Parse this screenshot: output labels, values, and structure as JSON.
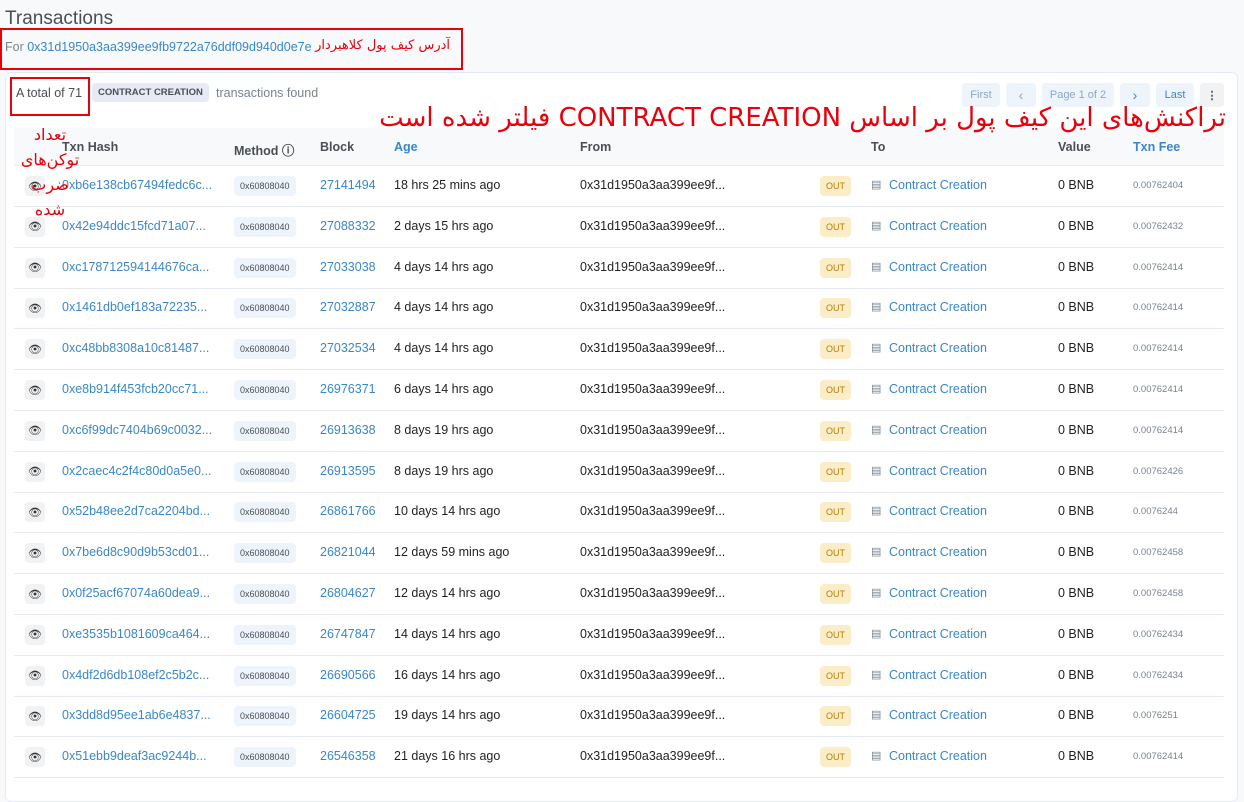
{
  "page": {
    "title": "Transactions",
    "for_label": "For",
    "address": "0x31d1950a3aa399ee9fb9722a76ddf09d940d0e7e"
  },
  "annotations": {
    "address_note": "آدرس کیف پول کلاهبردار",
    "filter_note": "تراکنش‌های این کیف پول بر اساس CONTRACT CREATION فیلتر شده است",
    "count_note": "تعداد توکن‌های ضرب شده",
    "color": "#e8000b"
  },
  "summary": {
    "total": "A total of 71",
    "filter_badge": "CONTRACT CREATION",
    "found": "transactions found"
  },
  "pagination": {
    "first": "First",
    "prev": "‹",
    "page": "Page 1 of 2",
    "next": "›",
    "last": "Last",
    "more": "⋮"
  },
  "columns": {
    "hash": "Txn Hash",
    "method": "Method ⓘ",
    "block": "Block",
    "age": "Age",
    "from": "From",
    "to": "To",
    "value": "Value",
    "fee": "Txn Fee"
  },
  "rows": [
    {
      "hash": "0xb6e138cb67494fedc6c...",
      "method": "0x60808040",
      "block": "27141494",
      "age": "18 hrs 25 mins ago",
      "from": "0x31d1950a3aa399ee9f...",
      "dir": "OUT",
      "to": "Contract Creation",
      "value": "0 BNB",
      "fee": "0.00762404"
    },
    {
      "hash": "0x42e94ddc15fcd71a07...",
      "method": "0x60808040",
      "block": "27088332",
      "age": "2 days 15 hrs ago",
      "from": "0x31d1950a3aa399ee9f...",
      "dir": "OUT",
      "to": "Contract Creation",
      "value": "0 BNB",
      "fee": "0.00762432"
    },
    {
      "hash": "0xc178712594144676ca...",
      "method": "0x60808040",
      "block": "27033038",
      "age": "4 days 14 hrs ago",
      "from": "0x31d1950a3aa399ee9f...",
      "dir": "OUT",
      "to": "Contract Creation",
      "value": "0 BNB",
      "fee": "0.00762414"
    },
    {
      "hash": "0x1461db0ef183a72235...",
      "method": "0x60808040",
      "block": "27032887",
      "age": "4 days 14 hrs ago",
      "from": "0x31d1950a3aa399ee9f...",
      "dir": "OUT",
      "to": "Contract Creation",
      "value": "0 BNB",
      "fee": "0.00762414"
    },
    {
      "hash": "0xc48bb8308a10c81487...",
      "method": "0x60808040",
      "block": "27032534",
      "age": "4 days 14 hrs ago",
      "from": "0x31d1950a3aa399ee9f...",
      "dir": "OUT",
      "to": "Contract Creation",
      "value": "0 BNB",
      "fee": "0.00762414"
    },
    {
      "hash": "0xe8b914f453fcb20cc71...",
      "method": "0x60808040",
      "block": "26976371",
      "age": "6 days 14 hrs ago",
      "from": "0x31d1950a3aa399ee9f...",
      "dir": "OUT",
      "to": "Contract Creation",
      "value": "0 BNB",
      "fee": "0.00762414"
    },
    {
      "hash": "0xc6f99dc7404b69c0032...",
      "method": "0x60808040",
      "block": "26913638",
      "age": "8 days 19 hrs ago",
      "from": "0x31d1950a3aa399ee9f...",
      "dir": "OUT",
      "to": "Contract Creation",
      "value": "0 BNB",
      "fee": "0.00762414"
    },
    {
      "hash": "0x2caec4c2f4c80d0a5e0...",
      "method": "0x60808040",
      "block": "26913595",
      "age": "8 days 19 hrs ago",
      "from": "0x31d1950a3aa399ee9f...",
      "dir": "OUT",
      "to": "Contract Creation",
      "value": "0 BNB",
      "fee": "0.00762426"
    },
    {
      "hash": "0x52b48ee2d7ca2204bd...",
      "method": "0x60808040",
      "block": "26861766",
      "age": "10 days 14 hrs ago",
      "from": "0x31d1950a3aa399ee9f...",
      "dir": "OUT",
      "to": "Contract Creation",
      "value": "0 BNB",
      "fee": "0.0076244"
    },
    {
      "hash": "0x7be6d8c90d9b53cd01...",
      "method": "0x60808040",
      "block": "26821044",
      "age": "12 days 59 mins ago",
      "from": "0x31d1950a3aa399ee9f...",
      "dir": "OUT",
      "to": "Contract Creation",
      "value": "0 BNB",
      "fee": "0.00762458"
    },
    {
      "hash": "0x0f25acf67074a60dea9...",
      "method": "0x60808040",
      "block": "26804627",
      "age": "12 days 14 hrs ago",
      "from": "0x31d1950a3aa399ee9f...",
      "dir": "OUT",
      "to": "Contract Creation",
      "value": "0 BNB",
      "fee": "0.00762458"
    },
    {
      "hash": "0xe3535b1081609ca464...",
      "method": "0x60808040",
      "block": "26747847",
      "age": "14 days 14 hrs ago",
      "from": "0x31d1950a3aa399ee9f...",
      "dir": "OUT",
      "to": "Contract Creation",
      "value": "0 BNB",
      "fee": "0.00762434"
    },
    {
      "hash": "0x4df2d6db108ef2c5b2c...",
      "method": "0x60808040",
      "block": "26690566",
      "age": "16 days 14 hrs ago",
      "from": "0x31d1950a3aa399ee9f...",
      "dir": "OUT",
      "to": "Contract Creation",
      "value": "0 BNB",
      "fee": "0.00762434"
    },
    {
      "hash": "0x3dd8d95ee1ab6e4837...",
      "method": "0x60808040",
      "block": "26604725",
      "age": "19 days 14 hrs ago",
      "from": "0x31d1950a3aa399ee9f...",
      "dir": "OUT",
      "to": "Contract Creation",
      "value": "0 BNB",
      "fee": "0.0076251"
    },
    {
      "hash": "0x51ebb9deaf3ac9244b...",
      "method": "0x60808040",
      "block": "26546358",
      "age": "21 days 16 hrs ago",
      "from": "0x31d1950a3aa399ee9f...",
      "dir": "OUT",
      "to": "Contract Creation",
      "value": "0 BNB",
      "fee": "0.00762414"
    }
  ]
}
